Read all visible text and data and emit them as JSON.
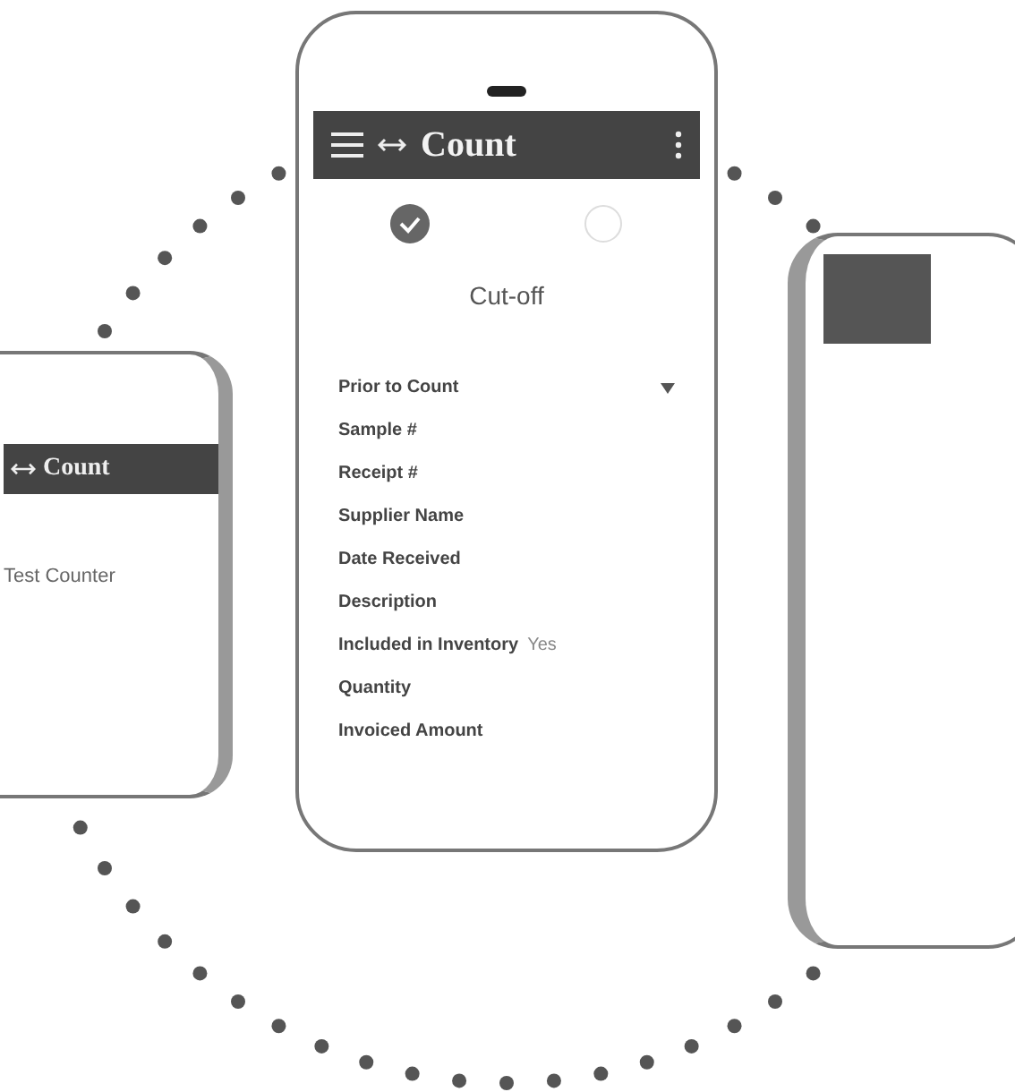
{
  "main_phone": {
    "app_bar": {
      "title": "Count"
    },
    "steps": [
      {
        "done": true
      },
      {
        "done": false
      }
    ],
    "heading": "Cut-off",
    "fields": [
      {
        "kind": "dropdown",
        "label": "Prior to Count"
      },
      {
        "kind": "text",
        "label": "Sample #"
      },
      {
        "kind": "text",
        "label": "Receipt #"
      },
      {
        "kind": "text",
        "label": "Supplier Name"
      },
      {
        "kind": "text",
        "label": "Date Received"
      },
      {
        "kind": "text",
        "label": "Description"
      },
      {
        "kind": "text",
        "label": "Included in Inventory",
        "value": "Yes"
      },
      {
        "kind": "text",
        "label": "Quantity"
      },
      {
        "kind": "text",
        "label": "Invoiced Amount"
      }
    ]
  },
  "left_phone": {
    "app_bar": {
      "title": "Count"
    },
    "heading": "Test Counter"
  }
}
